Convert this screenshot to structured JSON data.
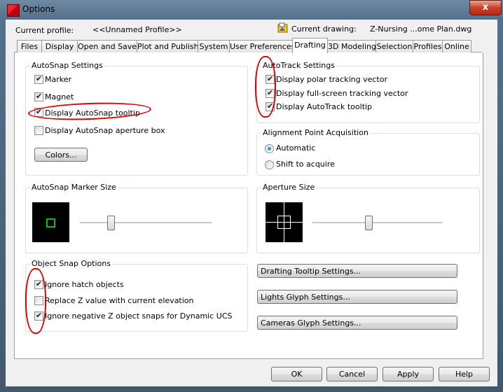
{
  "window": {
    "title": "Options",
    "close_glyph": "x"
  },
  "header": {
    "current_profile_label": "Current profile:",
    "current_profile_value": "<<Unnamed Profile>>",
    "current_drawing_label": "Current drawing:",
    "current_drawing_value": "Z-Nursing ...ome Plan.dwg"
  },
  "tabs": [
    {
      "label": "Files"
    },
    {
      "label": "Display"
    },
    {
      "label": "Open and Save"
    },
    {
      "label": "Plot and Publish"
    },
    {
      "label": "System"
    },
    {
      "label": "User Preferences"
    },
    {
      "label": "Drafting"
    },
    {
      "label": "3D Modeling"
    },
    {
      "label": "Selection"
    },
    {
      "label": "Profiles"
    },
    {
      "label": "Online"
    }
  ],
  "active_tab": "Drafting",
  "autosnap": {
    "title": "AutoSnap Settings",
    "marker": {
      "label": "Marker",
      "checked": true
    },
    "magnet": {
      "label": "Magnet",
      "checked": true
    },
    "tooltip": {
      "label": "Display AutoSnap tooltip",
      "checked": true
    },
    "aperture_box": {
      "label": "Display AutoSnap aperture box",
      "checked": false
    },
    "colors_button": "Colors..."
  },
  "autotrack": {
    "title": "AutoTrack Settings",
    "polar": {
      "label": "Display polar tracking vector",
      "checked": true
    },
    "fullscreen": {
      "label": "Display full-screen tracking vector",
      "checked": true
    },
    "tooltip": {
      "label": "Display AutoTrack tooltip",
      "checked": true
    }
  },
  "alignment": {
    "title": "Alignment Point Acquisition",
    "automatic": {
      "label": "Automatic",
      "selected": true
    },
    "shift": {
      "label": "Shift to acquire",
      "selected": false
    }
  },
  "marker_size": {
    "title": "AutoSnap Marker Size",
    "level": 0.22
  },
  "aperture_size": {
    "title": "Aperture Size",
    "level": 0.43
  },
  "object_snap": {
    "title": "Object Snap Options",
    "ignore_hatch": {
      "label": "Ignore hatch objects",
      "checked": true
    },
    "replace_z": {
      "label": "Replace Z value with current elevation",
      "checked": false
    },
    "ignore_negative_z": {
      "label": "Ignore negative Z object snaps for Dynamic UCS",
      "checked": true
    }
  },
  "side_buttons": {
    "drafting_tooltip": "Drafting Tooltip Settings...",
    "lights_glyph": "Lights Glyph Settings...",
    "cameras_glyph": "Cameras Glyph Settings..."
  },
  "footer": {
    "ok": "OK",
    "cancel": "Cancel",
    "apply": "Apply",
    "help": "Help"
  },
  "colors": {
    "marker_green": "#00c000",
    "annotation_red": "#e00000"
  }
}
